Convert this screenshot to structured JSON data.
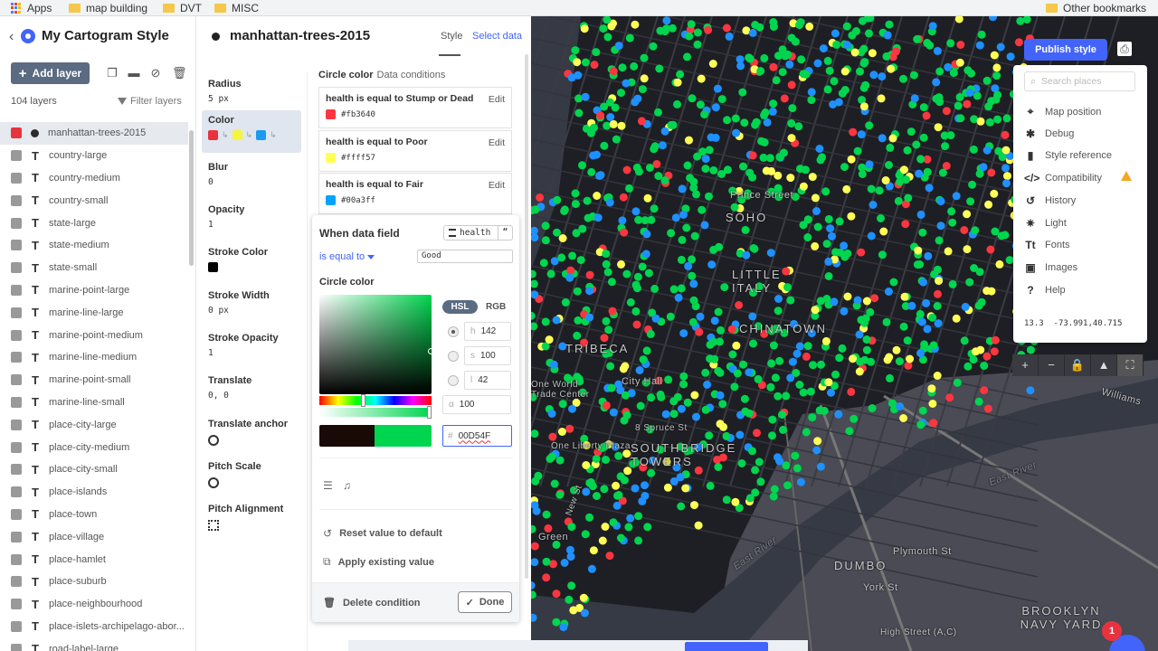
{
  "bookmarks": {
    "items": [
      "Apps",
      "map building",
      "DVT",
      "MISC"
    ],
    "other": "Other bookmarks"
  },
  "left": {
    "title": "My Cartogram Style",
    "add_layer": "Add layer",
    "layer_count": "104 layers",
    "filter": "Filter layers",
    "layers": [
      "manhattan-trees-2015",
      "country-large",
      "country-medium",
      "country-small",
      "state-large",
      "state-medium",
      "state-small",
      "marine-point-large",
      "marine-line-large",
      "marine-point-medium",
      "marine-line-medium",
      "marine-point-small",
      "marine-line-small",
      "place-city-large",
      "place-city-medium",
      "place-city-small",
      "place-islands",
      "place-town",
      "place-village",
      "place-hamlet",
      "place-suburb",
      "place-neighbourhood",
      "place-islets-archipelago-abor...",
      "road-label-large"
    ]
  },
  "layer": {
    "title": "manhattan-trees-2015",
    "tab_style": "Style",
    "tab_data": "Select data"
  },
  "props": {
    "radius": {
      "name": "Radius",
      "value": "5 px"
    },
    "color": {
      "name": "Color"
    },
    "blur": {
      "name": "Blur",
      "value": "0"
    },
    "opacity": {
      "name": "Opacity",
      "value": "1"
    },
    "stroke_color": {
      "name": "Stroke Color"
    },
    "stroke_width": {
      "name": "Stroke Width",
      "value": "0 px"
    },
    "stroke_opacity": {
      "name": "Stroke Opacity",
      "value": "1"
    },
    "translate": {
      "name": "Translate",
      "value": "0, 0"
    },
    "translate_anchor": {
      "name": "Translate anchor"
    },
    "pitch_scale": {
      "name": "Pitch Scale"
    },
    "pitch_alignment": {
      "name": "Pitch Alignment"
    }
  },
  "circle_color": {
    "label": "Circle color",
    "sub": "Data conditions",
    "edit": "Edit",
    "conditions": [
      {
        "text": "health is equal to Stump or Dead",
        "hex": "#fb3640",
        "color": "#fb3640"
      },
      {
        "text": "health is equal to Poor",
        "hex": "#ffff57",
        "color": "#ffff57"
      },
      {
        "text": "health is equal to Fair",
        "hex": "#00a3ff",
        "color": "#00a3ff"
      }
    ]
  },
  "popover": {
    "when": "When data field",
    "field": "health",
    "operator": "is equal to",
    "value": "Good",
    "circle_color": "Circle color",
    "hsl": "HSL",
    "rgb": "RGB",
    "h_key": "h",
    "h": "142",
    "s_key": "s",
    "s": "100",
    "l_key": "l",
    "l": "42",
    "a_key": "α",
    "a": "100",
    "hex_key": "#",
    "hex": "00D54F",
    "reset": "Reset value to default",
    "apply": "Apply existing value",
    "delete": "Delete condition",
    "done": "Done",
    "current_color": "#00d54f"
  },
  "map": {
    "publish": "Publish style",
    "search_placeholder": "Search places",
    "tools": [
      "Map position",
      "Debug",
      "Style reference",
      "Compatibility",
      "History",
      "Light",
      "Fonts",
      "Images",
      "Help"
    ],
    "zoom": "13.3",
    "lnglat": "-73.991,40.715",
    "labels": {
      "soho": "SOHO",
      "little_italy": "LITTLE ITALY",
      "chinatown": "CHINATOWN",
      "tribeca": "TRIBECA",
      "south_bridge": "SOUTHBRIDGE TOWERS",
      "dumbo": "DUMBO",
      "bny": "BROOKLYN NAVY YARD",
      "prince": "Prince Street",
      "city_hall": "City Hall",
      "wtc": "One World Trade Center",
      "spruce": "8 Spruce St",
      "one_liberty": "One Liberty Plaza",
      "plymouth": "Plymouth St",
      "york": "York St",
      "high_st": "High Street (A,C)",
      "east_river": "East River",
      "east_river2": "East River",
      "williams": "Williams",
      "green": "Green",
      "new_st": "New St"
    },
    "notifications": "1"
  }
}
